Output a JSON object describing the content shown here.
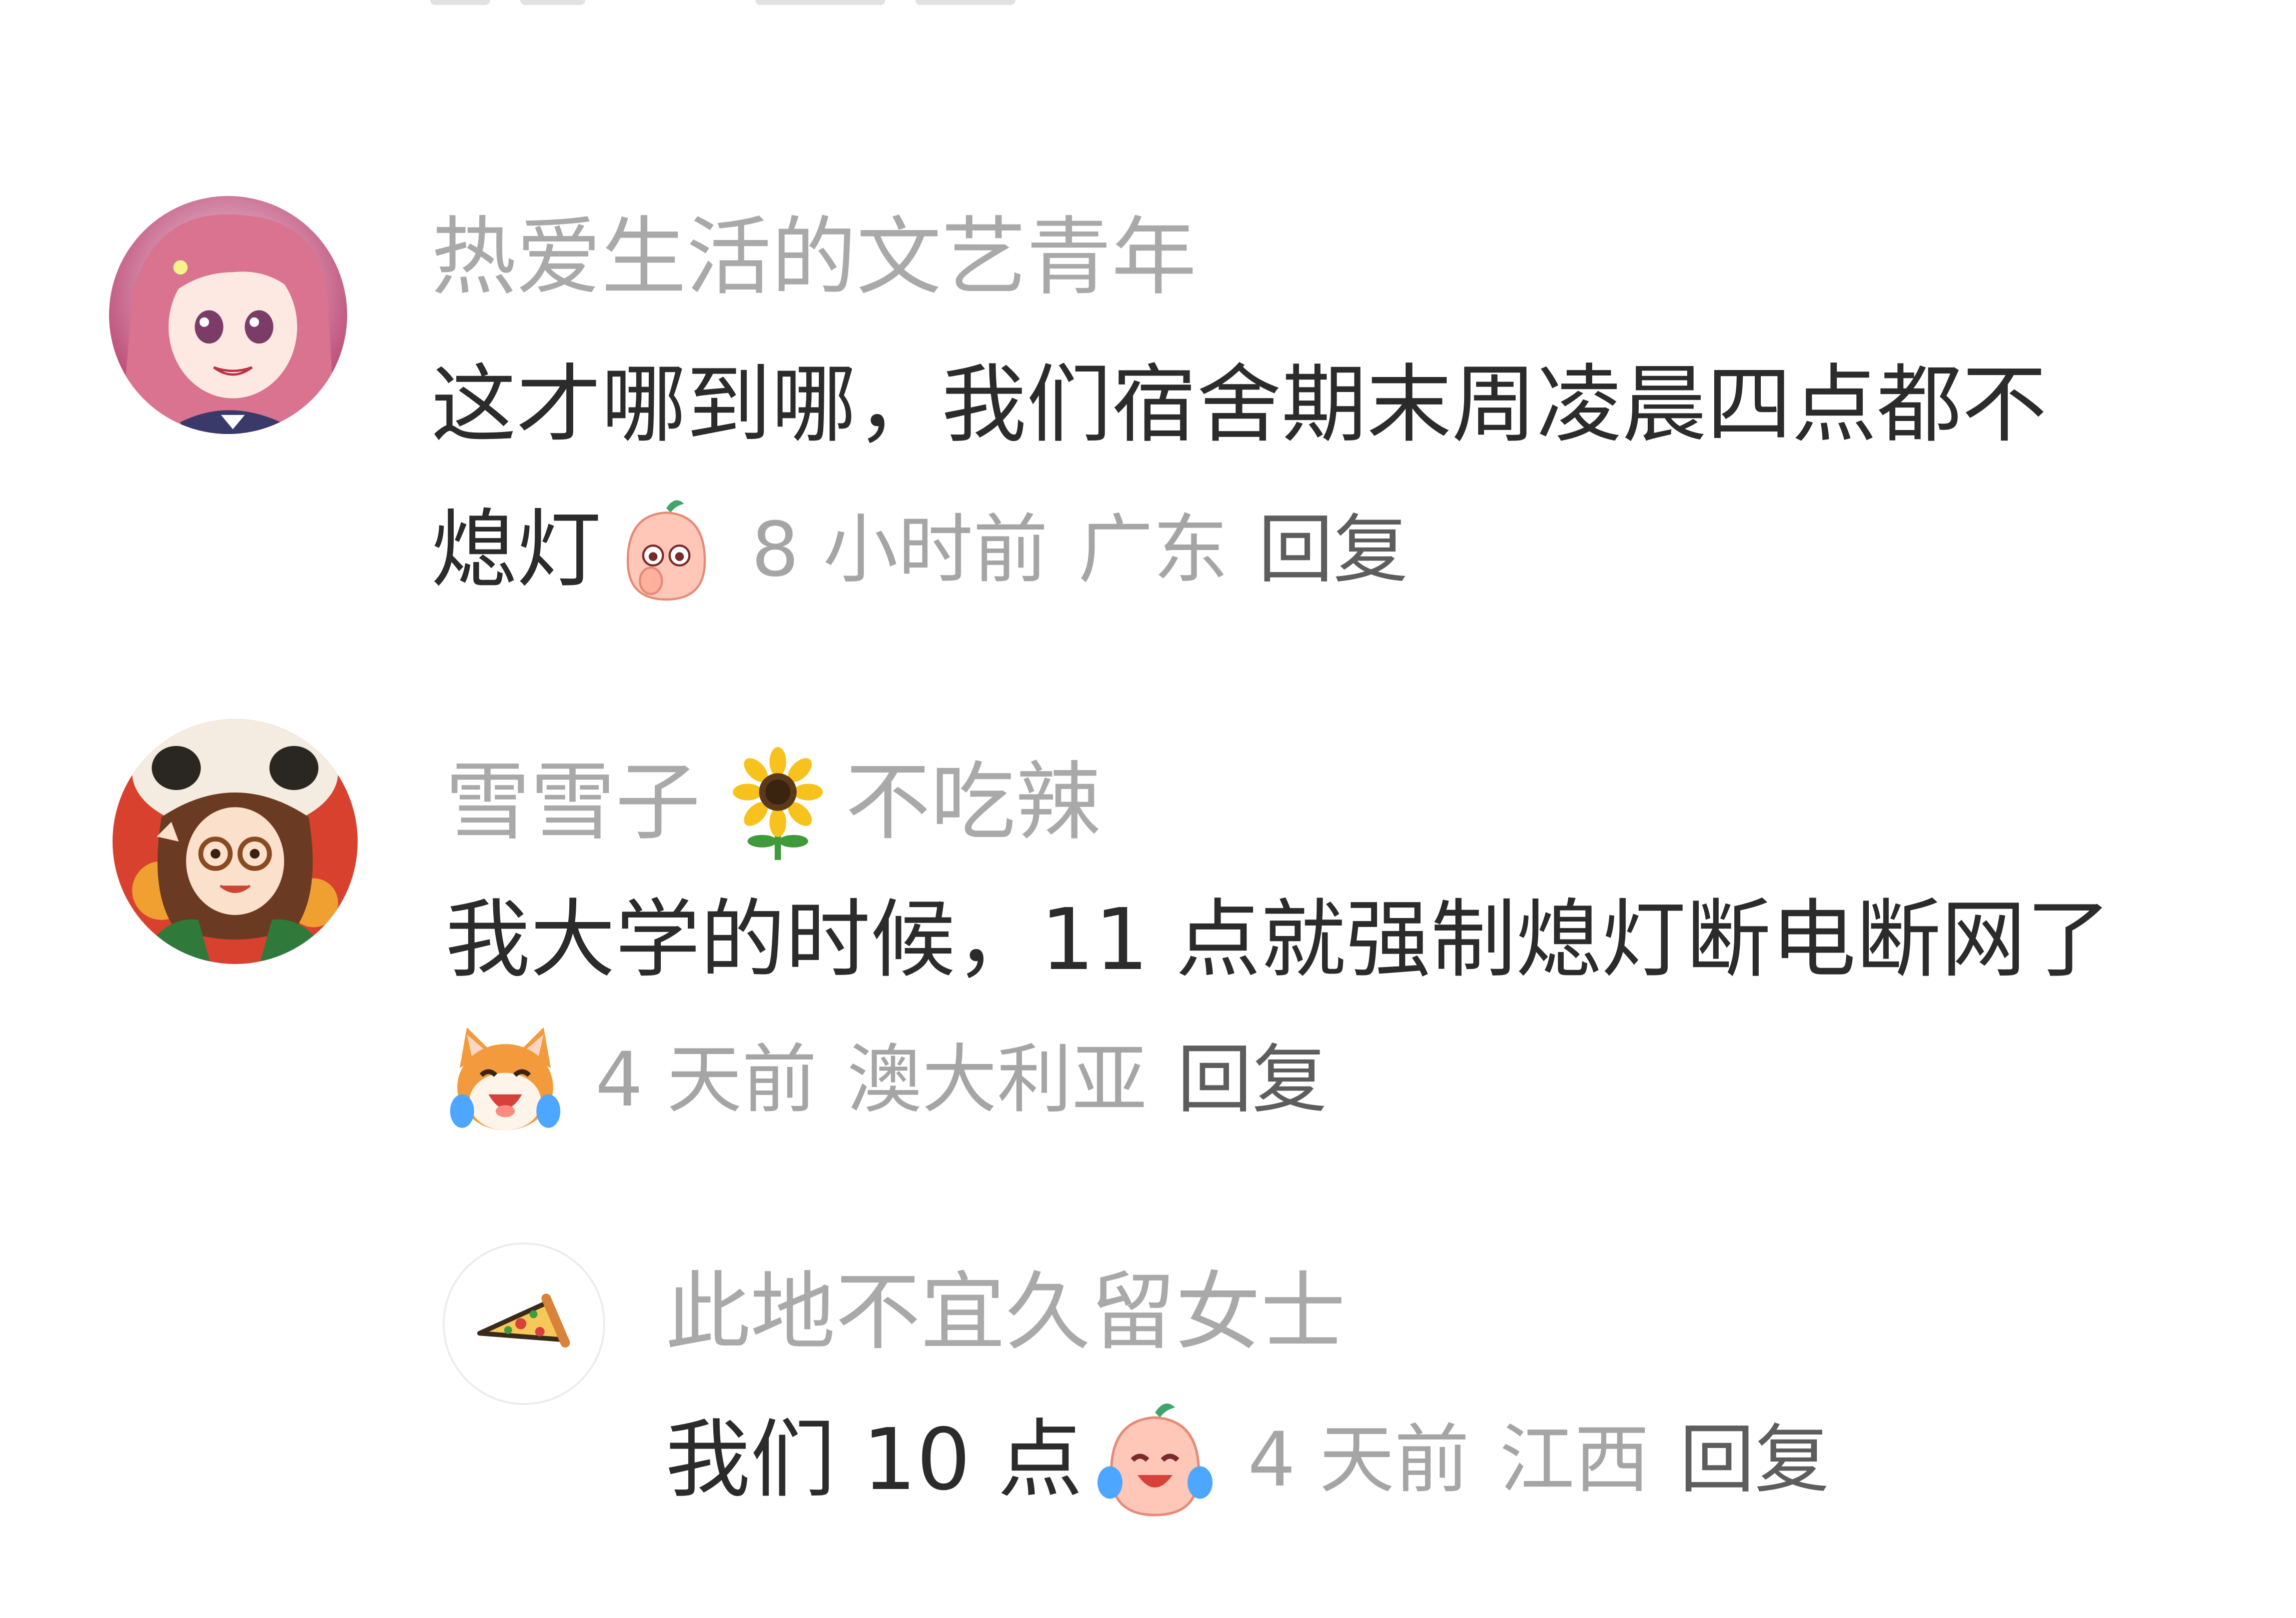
{
  "comments": [
    {
      "author": "热爱生活的文艺青年",
      "text_line1": "这才哪到哪，我们宿舍期末周凌晨四点都不",
      "text_line2": "熄灯",
      "emoji": "peach-covering-mouth-emoji",
      "time": "8 小时前",
      "location": "广东",
      "reply_label": "回复",
      "avatar": "anime-girl-pink-hair-avatar"
    },
    {
      "author": "雪雪子",
      "author_suffix": "不吃辣",
      "author_emoji": "sunflower-emoji",
      "text_line1": "我大学的时候，11 点就强制熄灯断电断网了",
      "emoji": "cat-laughing-tears-emoji",
      "time": "4 天前",
      "location": "澳大利亚",
      "reply_label": "回复",
      "avatar": "panda-hat-girl-avatar"
    },
    {
      "author": "此地不宜久留女士",
      "text_line1": "我们 10 点",
      "emoji": "peach-laughing-tears-emoji",
      "time": "4 天前",
      "location": "江西",
      "reply_label": "回复",
      "avatar": "pizza-slice-avatar"
    }
  ],
  "colors": {
    "author": "#a9a9a9",
    "text": "#2b2b2b",
    "meta": "#a5a5a5",
    "reply": "#5d5d5d"
  }
}
